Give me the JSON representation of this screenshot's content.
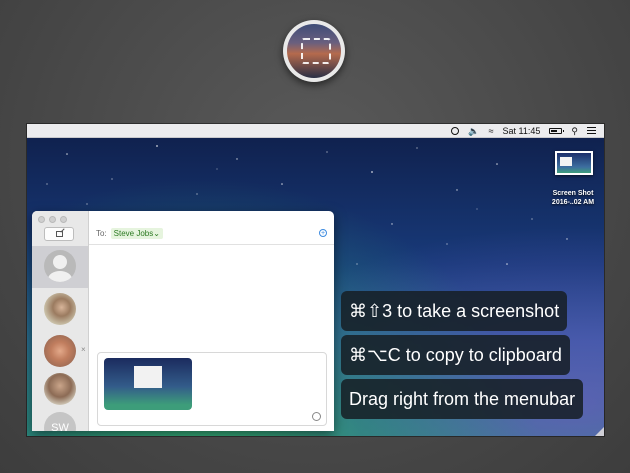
{
  "app_icon": {
    "icon": "screenshot-app-icon"
  },
  "menubar": {
    "items": [
      "status-ring-icon",
      "volume-icon",
      "wifi-icon"
    ],
    "clock": "Sat 11:45",
    "right_icons": [
      "battery-icon",
      "search-icon",
      "menu-list-icon"
    ]
  },
  "desktop_file": {
    "label_line1": "Screen Shot",
    "label_line2": "2016-..02 AM"
  },
  "messages": {
    "to_label": "To:",
    "recipient": "Steve Jobs",
    "add_icon": "plus-circle-icon",
    "conversations": [
      {
        "avatar": "generic",
        "selected": true
      },
      {
        "avatar": "photo",
        "selected": false
      },
      {
        "avatar": "photo",
        "selected": false,
        "close": "×"
      },
      {
        "avatar": "photo",
        "selected": false
      },
      {
        "avatar": "initials",
        "initials": "SW",
        "selected": false
      }
    ],
    "attachment": "screenshot-thumbnail"
  },
  "hints": [
    "⌘⇧3 to take a screenshot",
    "⌘⌥C to copy to clipboard",
    "Drag right from the menubar"
  ],
  "colors": {
    "background": "#4a4a4a",
    "chip_bg": "#e6f4de",
    "chip_text": "#2c7a22",
    "accent": "#3d8be0",
    "hint_bg": "#161e24"
  }
}
